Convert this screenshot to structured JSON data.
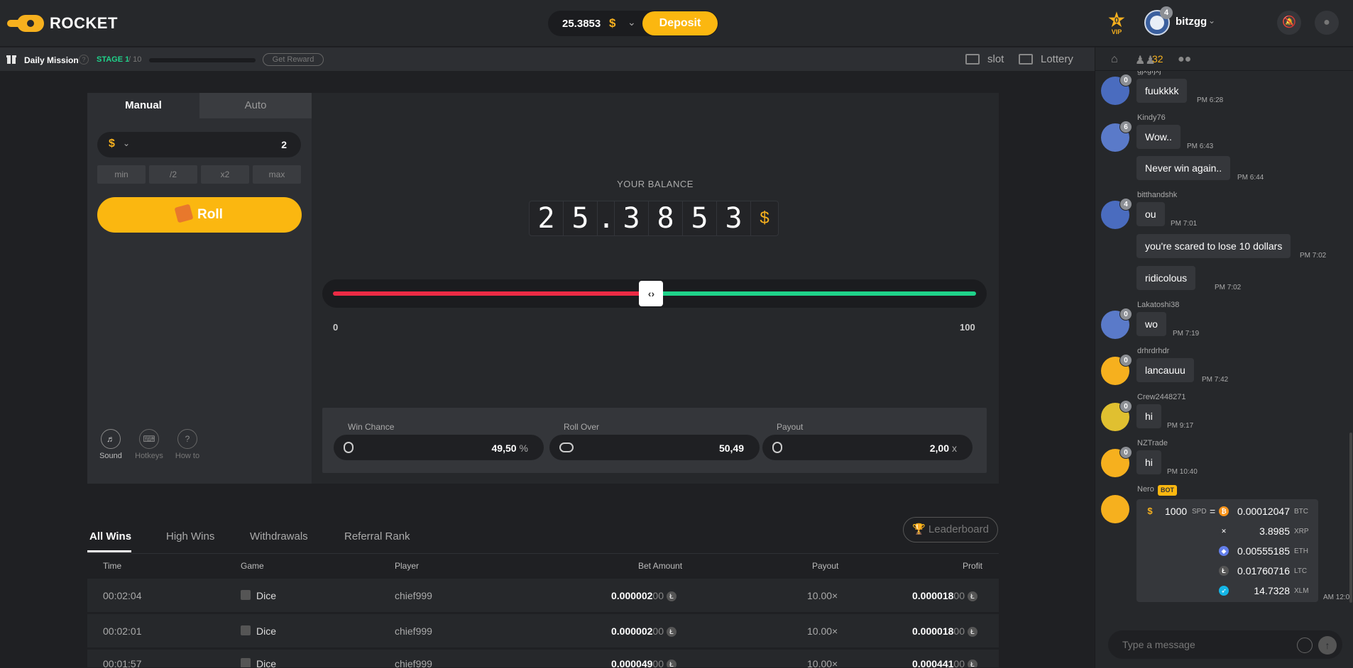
{
  "brand": {
    "logo_text": "ROCKET"
  },
  "header": {
    "balance": "25.3853",
    "currency_symbol": "$",
    "deposit_label": "Deposit",
    "vip_level": "0",
    "vip_label": "VIP",
    "user_level": "4",
    "username": "bitzgg"
  },
  "mission": {
    "label": "Daily Mission",
    "stage_label": "STAGE 1",
    "stage_total": "/ 10",
    "progress": 0,
    "reward_label": "Get Reward"
  },
  "nav": {
    "slot": "slot",
    "lottery": "Lottery"
  },
  "bet": {
    "tabs": [
      "Manual",
      "Auto"
    ],
    "currency_symbol": "$",
    "amount": "2",
    "quick": [
      "min",
      "/2",
      "x2",
      "max"
    ],
    "roll_label": "Roll",
    "tools": [
      "Sound",
      "Hotkeys",
      "How to"
    ]
  },
  "game": {
    "balance_label": "YOUR BALANCE",
    "digits": [
      "2",
      "5",
      ".",
      "3",
      "8",
      "5",
      "3"
    ],
    "currency_symbol": "$",
    "slider_min": "0",
    "slider_max": "100",
    "slider_value": 49.5,
    "stats": [
      {
        "label": "Win Chance",
        "value": "49,50",
        "unit": "%"
      },
      {
        "label": "Roll Over",
        "value": "50,49",
        "unit": ""
      },
      {
        "label": "Payout",
        "value": "2,00",
        "unit": "x"
      }
    ]
  },
  "wins": {
    "tabs": [
      "All Wins",
      "High Wins",
      "Withdrawals",
      "Referral Rank"
    ],
    "leaderboard_label": "Leaderboard",
    "columns": [
      "Time",
      "Game",
      "Player",
      "Bet Amount",
      "Payout",
      "Profit"
    ],
    "rows": [
      {
        "time": "00:02:04",
        "game": "Dice",
        "player": "chief999",
        "bet_main": "0.000002",
        "bet_tail": "00",
        "payout": "10.00×",
        "profit_main": "0.000018",
        "profit_tail": "00"
      },
      {
        "time": "00:02:01",
        "game": "Dice",
        "player": "chief999",
        "bet_main": "0.000002",
        "bet_tail": "00",
        "payout": "10.00×",
        "profit_main": "0.000018",
        "profit_tail": "00"
      },
      {
        "time": "00:01:57",
        "game": "Dice",
        "player": "chief999",
        "bet_main": "0.000049",
        "bet_tail": "00",
        "payout": "10.00×",
        "profit_main": "0.000441",
        "profit_tail": "00"
      }
    ]
  },
  "chat": {
    "online_count": "32",
    "placeholder": "Type a message",
    "messages": [
      {
        "name": "gjxgfjxj",
        "level": "0",
        "text": "fuukkkk",
        "time": "PM 6:28"
      },
      {
        "name": "Kindy76",
        "level": "6",
        "text": "Wow..",
        "time": "PM 6:43"
      },
      {
        "name": "",
        "level": "",
        "text": "Never win again..",
        "time": "PM 6:44"
      },
      {
        "name": "bitthandshk",
        "level": "4",
        "text": "ou",
        "time": "PM 7:01"
      },
      {
        "name": "",
        "level": "",
        "text": "you're scared to lose 10 dollars",
        "time": "PM 7:02"
      },
      {
        "name": "",
        "level": "",
        "text": "ridicolous",
        "time": "PM 7:02"
      },
      {
        "name": "Lakatoshi38",
        "level": "0",
        "text": "wo",
        "time": "PM 7:19"
      },
      {
        "name": "drhrdrhdr",
        "level": "0",
        "text": "lancauuu",
        "time": "PM 7:42"
      },
      {
        "name": "Crew2448271",
        "level": "0",
        "text": "hi",
        "time": "PM 9:17"
      },
      {
        "name": "NZTrade",
        "level": "0",
        "text": "hi",
        "time": "PM 10:40"
      }
    ],
    "bot": {
      "name": "Nero",
      "badge": "BOT",
      "amount": "1000",
      "unit": "SPD",
      "equals": "=",
      "time": "AM 12:0",
      "conversions": [
        {
          "value": "0.00012047",
          "cur": "BTC",
          "color": "#f7931a",
          "glyph": "₿"
        },
        {
          "value": "3.8985",
          "cur": "XRP",
          "color": "#35373b",
          "glyph": "✕"
        },
        {
          "value": "0.00555185",
          "cur": "ETH",
          "color": "#627eea",
          "glyph": "◆"
        },
        {
          "value": "0.01760716",
          "cur": "LTC",
          "color": "#555",
          "glyph": "Ł"
        },
        {
          "value": "14.7328",
          "cur": "XLM",
          "color": "#14b6e7",
          "glyph": "➶"
        }
      ]
    }
  },
  "colors": {
    "accent": "#fbb710",
    "red": "#ec2b45",
    "green": "#1fd28a"
  }
}
